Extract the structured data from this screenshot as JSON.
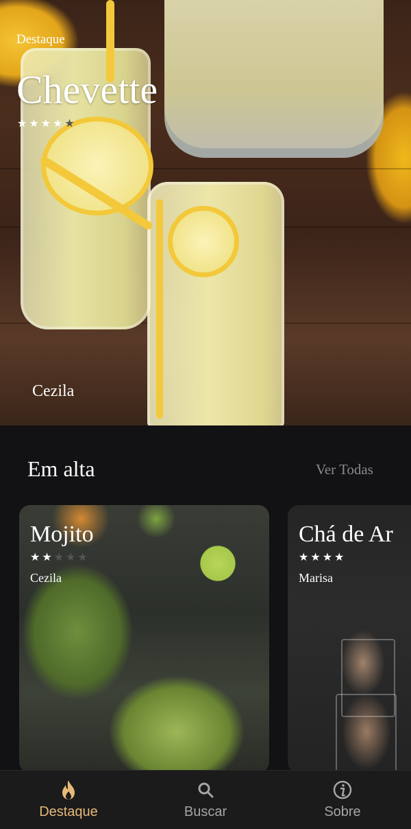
{
  "hero": {
    "label": "Destaque",
    "title": "Chevette",
    "rating": 4,
    "max_rating": 5,
    "author": "Cezila"
  },
  "trending": {
    "title": "Em alta",
    "see_all": "Ver Todas",
    "cards": [
      {
        "title": "Mojito",
        "rating": 2,
        "max_rating": 5,
        "author": "Cezila"
      },
      {
        "title": "Chá de Ar",
        "rating": 4,
        "max_rating": 4,
        "author": "Marisa"
      }
    ]
  },
  "bottom_nav": {
    "items": [
      {
        "label": "Destaque",
        "icon": "flame-icon",
        "active": true
      },
      {
        "label": "Buscar",
        "icon": "search-icon",
        "active": false
      },
      {
        "label": "Sobre",
        "icon": "info-icon",
        "active": false
      }
    ],
    "active_color": "#e7b978",
    "inactive_color": "#a6a6a6"
  }
}
